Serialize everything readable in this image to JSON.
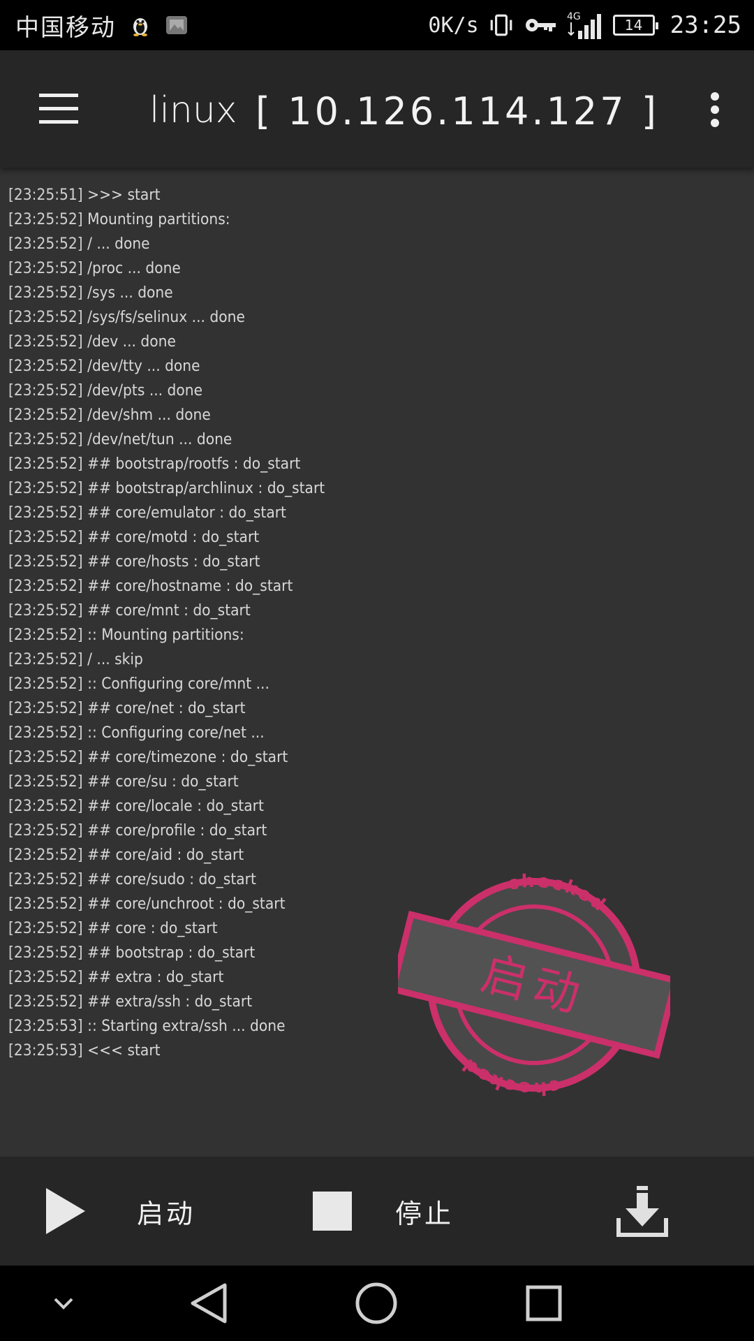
{
  "status_bar": {
    "carrier": "中国移动",
    "net_speed": "0K/s",
    "network_type": "4G",
    "battery_level": "14",
    "time": "23:25",
    "icons": [
      "qq-penguin-icon",
      "gallery-icon",
      "vibrate-icon",
      "vpn-key-icon",
      "signal-icon",
      "battery-icon"
    ]
  },
  "app_bar": {
    "title": "linux",
    "ip": "[ 10.126.114.127 ]",
    "menu_icon": "hamburger-menu-icon",
    "overflow_icon": "more-vert-icon"
  },
  "log": {
    "lines": [
      {
        "ts": "[23:25:51]",
        "msg": " >>> start"
      },
      {
        "ts": "[23:25:52]",
        "msg": " Mounting partitions:"
      },
      {
        "ts": "[23:25:52]",
        "msg": " / ... done"
      },
      {
        "ts": "[23:25:52]",
        "msg": " /proc ... done"
      },
      {
        "ts": "[23:25:52]",
        "msg": " /sys ... done"
      },
      {
        "ts": "[23:25:52]",
        "msg": " /sys/fs/selinux ... done"
      },
      {
        "ts": "[23:25:52]",
        "msg": " /dev ... done"
      },
      {
        "ts": "[23:25:52]",
        "msg": " /dev/tty ... done"
      },
      {
        "ts": "[23:25:52]",
        "msg": " /dev/pts ... done"
      },
      {
        "ts": "[23:25:52]",
        "msg": " /dev/shm ... done"
      },
      {
        "ts": "[23:25:52]",
        "msg": " /dev/net/tun ... done"
      },
      {
        "ts": "[23:25:52]",
        "msg": " ## bootstrap/rootfs : do_start"
      },
      {
        "ts": "[23:25:52]",
        "msg": " ## bootstrap/archlinux : do_start"
      },
      {
        "ts": "[23:25:52]",
        "msg": " ## core/emulator : do_start"
      },
      {
        "ts": "[23:25:52]",
        "msg": " ## core/motd : do_start"
      },
      {
        "ts": "[23:25:52]",
        "msg": " ## core/hosts : do_start"
      },
      {
        "ts": "[23:25:52]",
        "msg": " ## core/hostname : do_start"
      },
      {
        "ts": "[23:25:52]",
        "msg": " ## core/mnt : do_start"
      },
      {
        "ts": "[23:25:52]",
        "msg": " :: Mounting partitions:"
      },
      {
        "ts": "[23:25:52]",
        "msg": " / ... skip"
      },
      {
        "ts": "[23:25:52]",
        "msg": " :: Configuring core/mnt ..."
      },
      {
        "ts": "[23:25:52]",
        "msg": " ## core/net : do_start"
      },
      {
        "ts": "[23:25:52]",
        "msg": " :: Configuring core/net ..."
      },
      {
        "ts": "[23:25:52]",
        "msg": " ## core/timezone : do_start"
      },
      {
        "ts": "[23:25:52]",
        "msg": " ## core/su : do_start"
      },
      {
        "ts": "[23:25:52]",
        "msg": " ## core/locale : do_start"
      },
      {
        "ts": "[23:25:52]",
        "msg": " ## core/profile : do_start"
      },
      {
        "ts": "[23:25:52]",
        "msg": " ## core/aid : do_start"
      },
      {
        "ts": "[23:25:52]",
        "msg": " ## core/sudo : do_start"
      },
      {
        "ts": "[23:25:52]",
        "msg": " ## core/unchroot : do_start"
      },
      {
        "ts": "[23:25:52]",
        "msg": " ## core : do_start"
      },
      {
        "ts": "[23:25:52]",
        "msg": " ## bootstrap : do_start"
      },
      {
        "ts": "[23:25:52]",
        "msg": " ## extra : do_start"
      },
      {
        "ts": "[23:25:52]",
        "msg": " ## extra/ssh : do_start"
      },
      {
        "ts": "[23:25:53]",
        "msg": " :: Starting extra/ssh ... done"
      },
      {
        "ts": "[23:25:53]",
        "msg": " <<< start"
      }
    ]
  },
  "stamp": {
    "text": "启动",
    "ring_text": "checked",
    "color": "#d8306f"
  },
  "controls": {
    "start_label": "启动",
    "stop_label": "停止",
    "start_icon": "play-icon",
    "stop_icon": "stop-square-icon",
    "download_icon": "download-icon"
  },
  "nav_bar": {
    "icons": [
      "chevron-down-icon",
      "back-triangle-icon",
      "home-circle-icon",
      "recents-square-icon"
    ]
  },
  "colors": {
    "app_bar_bg": "#262626",
    "log_bg": "#323232",
    "status_bar_bg": "#000000",
    "accent_stamp": "#d8306f"
  }
}
